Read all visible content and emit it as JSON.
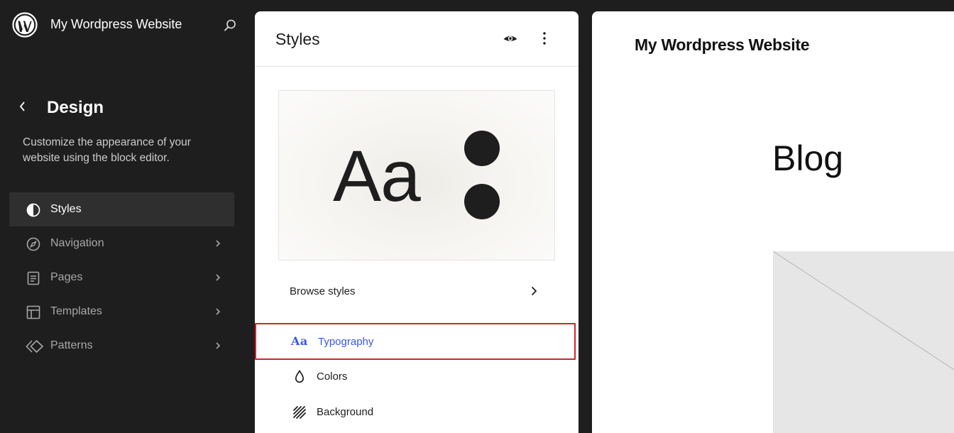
{
  "site_hub": {
    "title": "My Wordpress Website"
  },
  "sidebar": {
    "title": "Design",
    "description": "Customize the appearance of your website using the block editor.",
    "items": [
      {
        "label": "Styles",
        "icon": "half-circle-icon",
        "active": true
      },
      {
        "label": "Navigation",
        "icon": "compass-icon",
        "active": false
      },
      {
        "label": "Pages",
        "icon": "page-icon",
        "active": false
      },
      {
        "label": "Templates",
        "icon": "layout-icon",
        "active": false
      },
      {
        "label": "Patterns",
        "icon": "diamond-icon",
        "active": false
      }
    ]
  },
  "styles_panel": {
    "title": "Styles",
    "preview_text": "Aa",
    "browse_label": "Browse styles",
    "menu": [
      {
        "label": "Typography",
        "icon": "typography-icon",
        "icon_text": "Aa",
        "highlighted": true
      },
      {
        "label": "Colors",
        "icon": "droplet-icon"
      },
      {
        "label": "Background",
        "icon": "background-icon"
      }
    ]
  },
  "canvas": {
    "site_title": "My Wordpress Website",
    "heading": "Blog"
  },
  "colors": {
    "sidebar_bg": "#1e1e1e",
    "accent": "#3858e9",
    "highlight_border": "#d9212c"
  }
}
